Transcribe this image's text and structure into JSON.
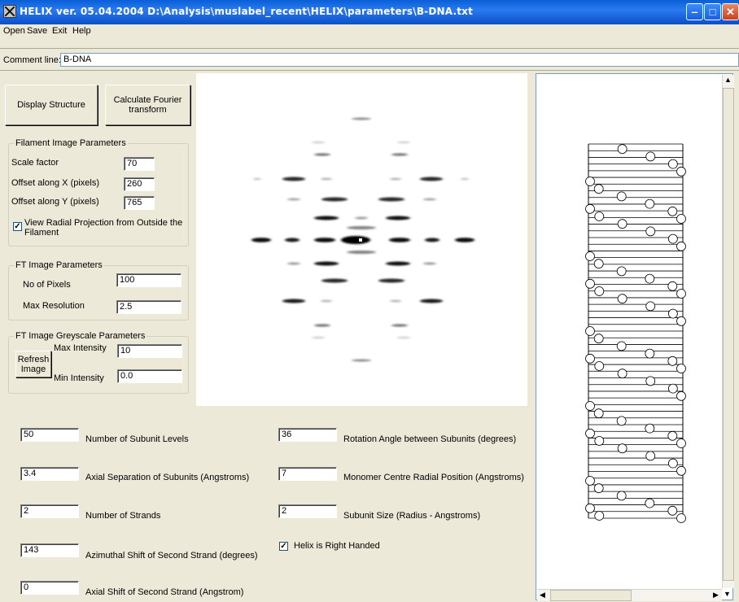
{
  "window": {
    "title": "HELIX ver. 05.04.2004  D:\\Analysis\\muslabel_recent\\HELIX\\parameters\\B-DNA.txt"
  },
  "menu": [
    "Open",
    "Save",
    "Exit",
    "Help"
  ],
  "comment": {
    "label": "Comment line:",
    "value": "B-DNA"
  },
  "buttons": {
    "display_structure": "Display Structure",
    "calc_ft": "Calculate  Fourier transform",
    "refresh_image": "Refresh Image"
  },
  "filament_params": {
    "title": "Filament Image Parameters",
    "scale_factor": {
      "label": "Scale factor",
      "value": "70"
    },
    "offset_x": {
      "label": "Offset along X (pixels)",
      "value": "260"
    },
    "offset_y": {
      "label": "Offset along Y (pixels)",
      "value": "765"
    },
    "radial_checkbox": {
      "label": "View Radial Projection from Outside the Filament",
      "checked": true
    }
  },
  "ft_params": {
    "title": "FT Image Parameters",
    "no_of_pixels": {
      "label": "No of Pixels",
      "value": "100"
    },
    "max_resolution": {
      "label": "Max Resolution",
      "value": "2.5"
    }
  },
  "greyscale_params": {
    "title": "FT Image Greyscale Parameters",
    "max_intensity": {
      "label": "Max Intensity",
      "value": "10"
    },
    "min_intensity": {
      "label": "Min Intensity",
      "value": "0.0"
    }
  },
  "helix_params": {
    "subunit_levels": {
      "label": "Number of Subunit Levels",
      "value": "50"
    },
    "axial_separation": {
      "label": "Axial Separation of Subunits (Angstroms)",
      "value": "3.4"
    },
    "strands": {
      "label": "Number of Strands",
      "value": "2"
    },
    "azimuthal_shift": {
      "label": "Azimuthal Shift of Second Strand (degrees)",
      "value": "143"
    },
    "axial_shift": {
      "label": "Axial Shift of Second Strand (Angstrom)",
      "value": "0"
    },
    "rotation_angle": {
      "label": "Rotation Angle between Subunits (degrees)",
      "value": "36"
    },
    "monomer_radial": {
      "label": "Monomer Centre Radial Position (Angstroms)",
      "value": "7"
    },
    "subunit_size": {
      "label": "Subunit Size (Radius - Angstroms)",
      "value": "2"
    },
    "right_handed": {
      "label": "Helix is Right Handed",
      "checked": true
    }
  },
  "icons": {
    "app": "helix-app-icon",
    "window_buttons": [
      "minimize-icon",
      "maximize-icon",
      "close-icon"
    ],
    "scroll": [
      "scroll-up-icon",
      "scroll-down-icon",
      "scroll-left-icon",
      "scroll-right-icon"
    ]
  },
  "colors": {
    "titlebar": "#0a5fd6",
    "window_bg": "#ece9d8",
    "canvas_bg": "#ffffff"
  }
}
